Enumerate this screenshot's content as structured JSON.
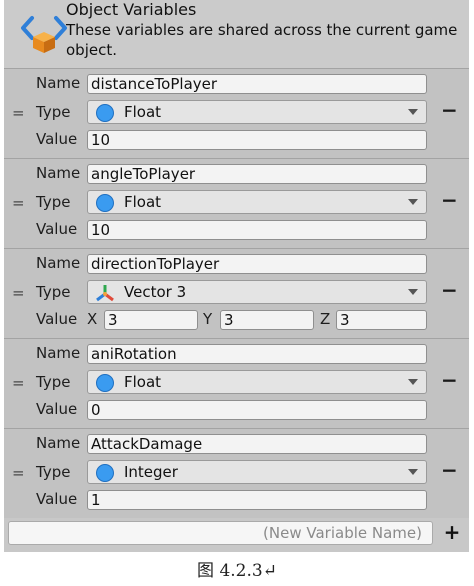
{
  "header": {
    "title": "Object Variables",
    "description": "These variables are shared across the current game object."
  },
  "labels": {
    "name": "Name",
    "type": "Type",
    "value": "Value",
    "x": "X",
    "y": "Y",
    "z": "Z",
    "drag_handle": "=",
    "remove": "−"
  },
  "variables": [
    {
      "name": "distanceToPlayer",
      "type": "Float",
      "type_icon": "float-circle-icon",
      "value": "10"
    },
    {
      "name": "angleToPlayer",
      "type": "Float",
      "type_icon": "float-circle-icon",
      "value": "10"
    },
    {
      "name": "directionToPlayer",
      "type": "Vector 3",
      "type_icon": "vector3-axes-icon",
      "value_x": "3",
      "value_y": "3",
      "value_z": "3"
    },
    {
      "name": "aniRotation",
      "type": "Float",
      "type_icon": "float-circle-icon",
      "value": "0"
    },
    {
      "name": "AttackDamage",
      "type": "Integer",
      "type_icon": "integer-circle-icon",
      "value": "1"
    }
  ],
  "footer": {
    "new_variable_placeholder": "(New Variable Name)",
    "add_label": "+"
  },
  "caption": "图 4.2.3↵",
  "colors": {
    "panel_bg": "#c8c8c8",
    "field_bg": "#f3f3f3",
    "type_circle": "#3a9bf0",
    "logo_blue": "#2f7fd8",
    "logo_orange": "#f29b2c"
  }
}
